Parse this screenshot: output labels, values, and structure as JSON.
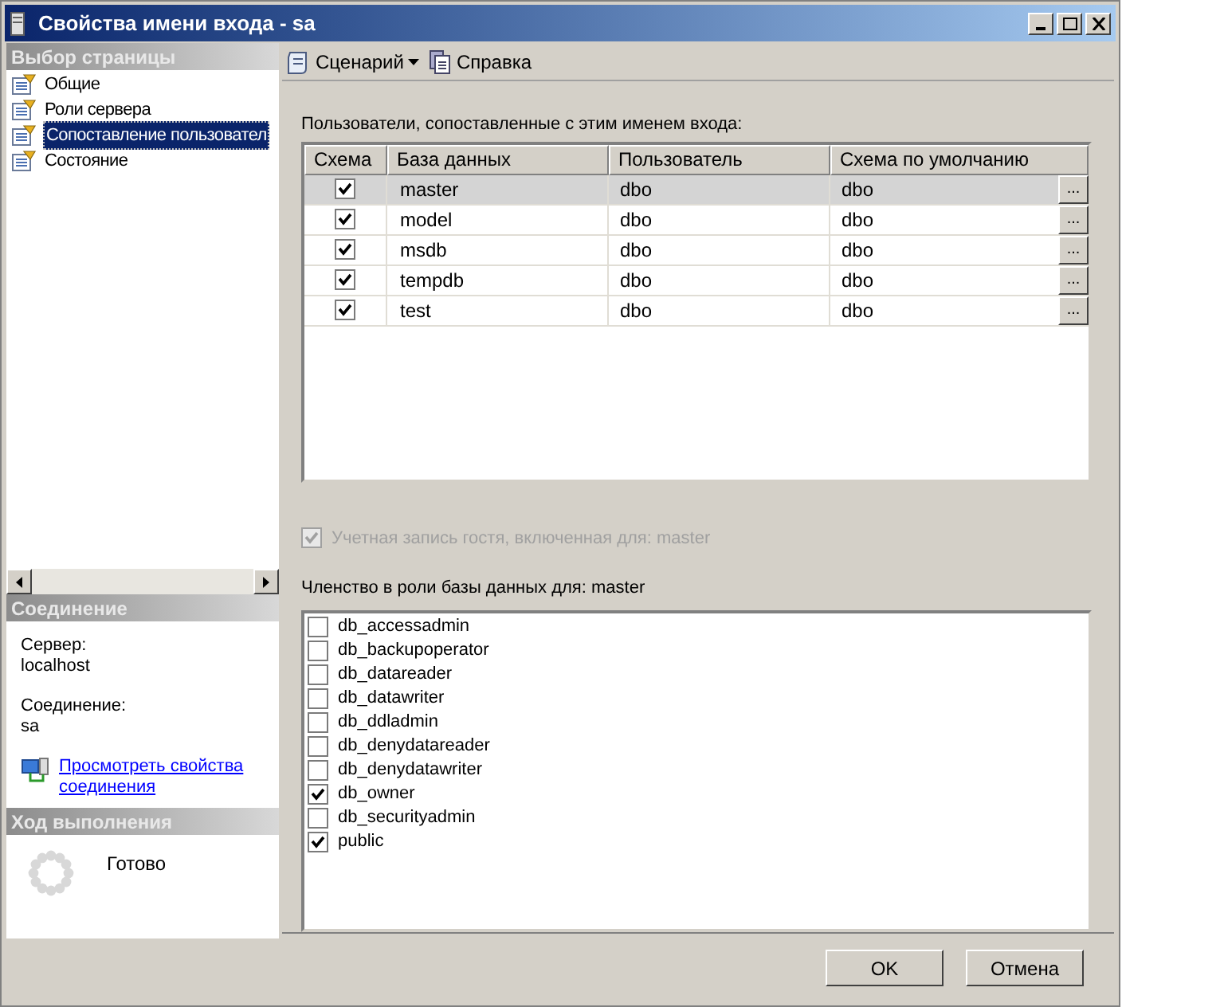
{
  "window": {
    "title": "Свойства имени входа - sa"
  },
  "sidebar": {
    "title": "Выбор страницы",
    "items": [
      {
        "label": "Общие",
        "selected": false
      },
      {
        "label": "Роли сервера",
        "selected": false
      },
      {
        "label": "Сопоставление пользовател",
        "selected": true
      },
      {
        "label": "Состояние",
        "selected": false
      }
    ]
  },
  "connection": {
    "title": "Соединение",
    "server_label": "Сервер:",
    "server": "localhost",
    "connection_label": "Соединение:",
    "connection": "sa",
    "link": "Просмотреть свойства соединения"
  },
  "progress": {
    "title": "Ход выполнения",
    "status": "Готово"
  },
  "toolbar": {
    "script": "Сценарий",
    "help": "Справка"
  },
  "users": {
    "label": "Пользователи, сопоставленные с этим именем входа:",
    "columns": [
      "Схема",
      "База данных",
      "Пользователь",
      "Схема по умолчанию"
    ],
    "rows": [
      {
        "checked": true,
        "database": "master",
        "user": "dbo",
        "schema": "dbo",
        "selected": true
      },
      {
        "checked": true,
        "database": "model",
        "user": "dbo",
        "schema": "dbo",
        "selected": false
      },
      {
        "checked": true,
        "database": "msdb",
        "user": "dbo",
        "schema": "dbo",
        "selected": false
      },
      {
        "checked": true,
        "database": "tempdb",
        "user": "dbo",
        "schema": "dbo",
        "selected": false
      },
      {
        "checked": true,
        "database": "test",
        "user": "dbo",
        "schema": "dbo",
        "selected": false
      }
    ],
    "browse_label": "..."
  },
  "guest": {
    "label": "Учетная запись гостя, включенная для: master",
    "checked": true,
    "disabled": true
  },
  "roles": {
    "label": "Членство в роли базы данных для: master",
    "items": [
      {
        "label": "db_accessadmin",
        "checked": false
      },
      {
        "label": "db_backupoperator",
        "checked": false
      },
      {
        "label": "db_datareader",
        "checked": false
      },
      {
        "label": "db_datawriter",
        "checked": false
      },
      {
        "label": "db_ddladmin",
        "checked": false
      },
      {
        "label": "db_denydatareader",
        "checked": false
      },
      {
        "label": "db_denydatawriter",
        "checked": false
      },
      {
        "label": "db_owner",
        "checked": true
      },
      {
        "label": "db_securityadmin",
        "checked": false
      },
      {
        "label": "public",
        "checked": true
      }
    ]
  },
  "buttons": [
    "OK",
    "Отмена"
  ]
}
